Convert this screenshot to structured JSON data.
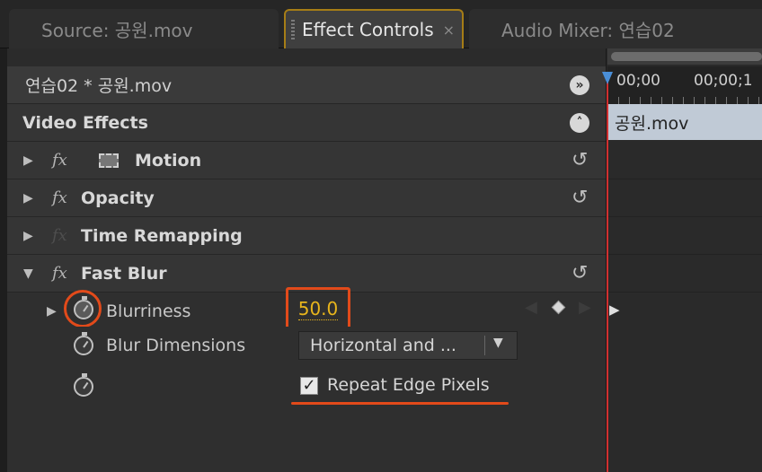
{
  "tabs": {
    "source": "Source: 공원.mov",
    "effect_controls": "Effect Controls",
    "effect_controls_close": "×",
    "audio_mixer": "Audio Mixer: 연습02"
  },
  "header": {
    "clip_name": "연습02 * 공원.mov",
    "section_title": "Video Effects",
    "expand_glyph": "»",
    "collapse_glyph": "˄"
  },
  "effects": [
    {
      "name": "Motion",
      "expanded": false
    },
    {
      "name": "Opacity",
      "expanded": false
    },
    {
      "name": "Time Remapping",
      "expanded": false
    },
    {
      "name": "Fast Blur",
      "expanded": true
    }
  ],
  "fast_blur": {
    "blurriness_label": "Blurriness",
    "blurriness_value": "50.0",
    "blur_dimensions_label": "Blur Dimensions",
    "blur_dimensions_value": "Horizontal and ...",
    "repeat_edge_label": "Repeat Edge Pixels",
    "repeat_edge_checked": true
  },
  "timeline": {
    "time_start": "00;00",
    "time_next": "00;00;1",
    "clip_label": "공원.mov"
  },
  "icons": {
    "reset": "reset-icon",
    "stopwatch": "stopwatch-icon",
    "fx": "fx-icon"
  },
  "colors": {
    "accent_tab_border": "#a67d16",
    "value_yellow": "#e8b51c",
    "annotation_red": "#e24a1a",
    "playhead_red": "#d03030"
  }
}
